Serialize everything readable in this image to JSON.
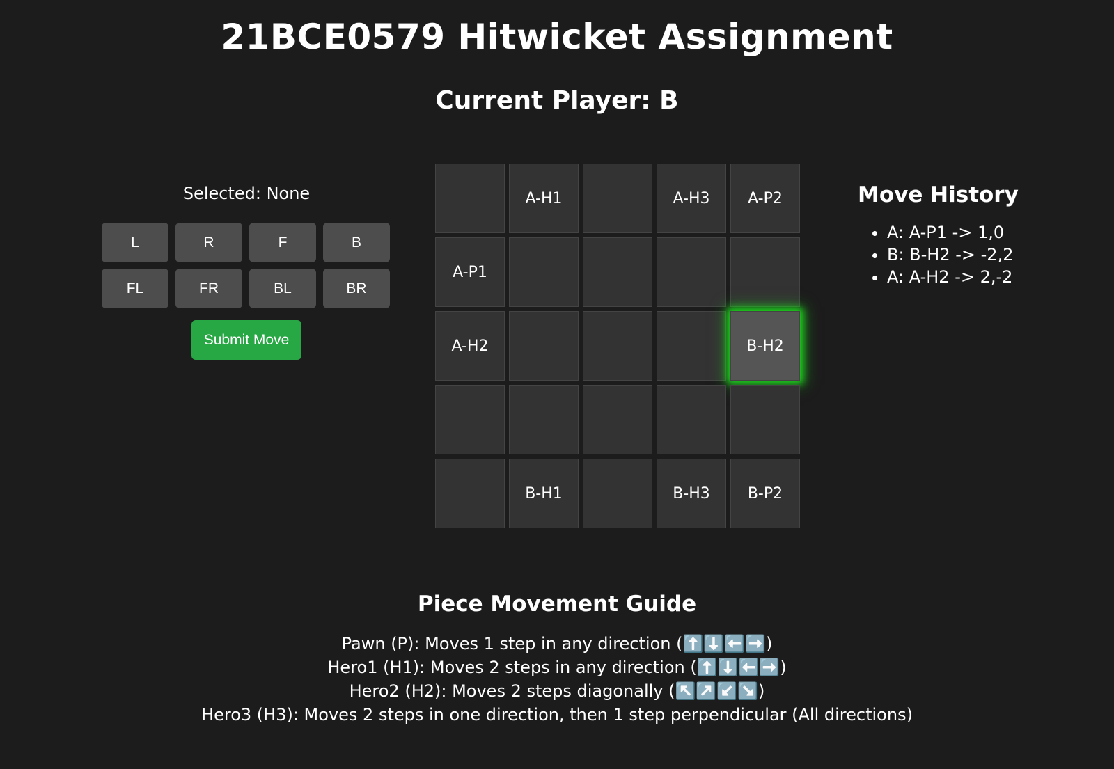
{
  "title": "21BCE0579 Hitwicket Assignment",
  "current_player": "Current Player: B",
  "controls": {
    "selected_text": "Selected: None",
    "move_buttons": [
      "L",
      "R",
      "F",
      "B",
      "FL",
      "FR",
      "BL",
      "BR"
    ],
    "submit_label": "Submit Move",
    "submit_color": "#28a745"
  },
  "board": {
    "rows": [
      [
        "",
        "A-H1",
        "",
        "A-H3",
        "A-P2"
      ],
      [
        "A-P1",
        "",
        "",
        "",
        ""
      ],
      [
        "A-H2",
        "",
        "",
        "",
        "B-H2"
      ],
      [
        "",
        "",
        "",
        "",
        ""
      ],
      [
        "",
        "B-H1",
        "",
        "B-H3",
        "B-P2"
      ]
    ],
    "highlighted_cell": "B-H2",
    "highlight_color": "#1fd41f"
  },
  "history": {
    "title": "Move History",
    "items": [
      "A: A-P1 -> 1,0",
      "B: B-H2 -> -2,2",
      "A: A-H2 -> 2,-2"
    ]
  },
  "guide": {
    "title": "Piece Movement Guide",
    "lines": [
      "Pawn (P): Moves 1 step in any direction (⬆️⬇️⬅️➡️)",
      "Hero1 (H1): Moves 2 steps in any direction (⬆️⬇️⬅️➡️)",
      "Hero2 (H2): Moves 2 steps diagonally (↖️↗️↙️↘️)",
      "Hero3 (H3): Moves 2 steps in one direction, then 1 step perpendicular (All directions)"
    ]
  }
}
